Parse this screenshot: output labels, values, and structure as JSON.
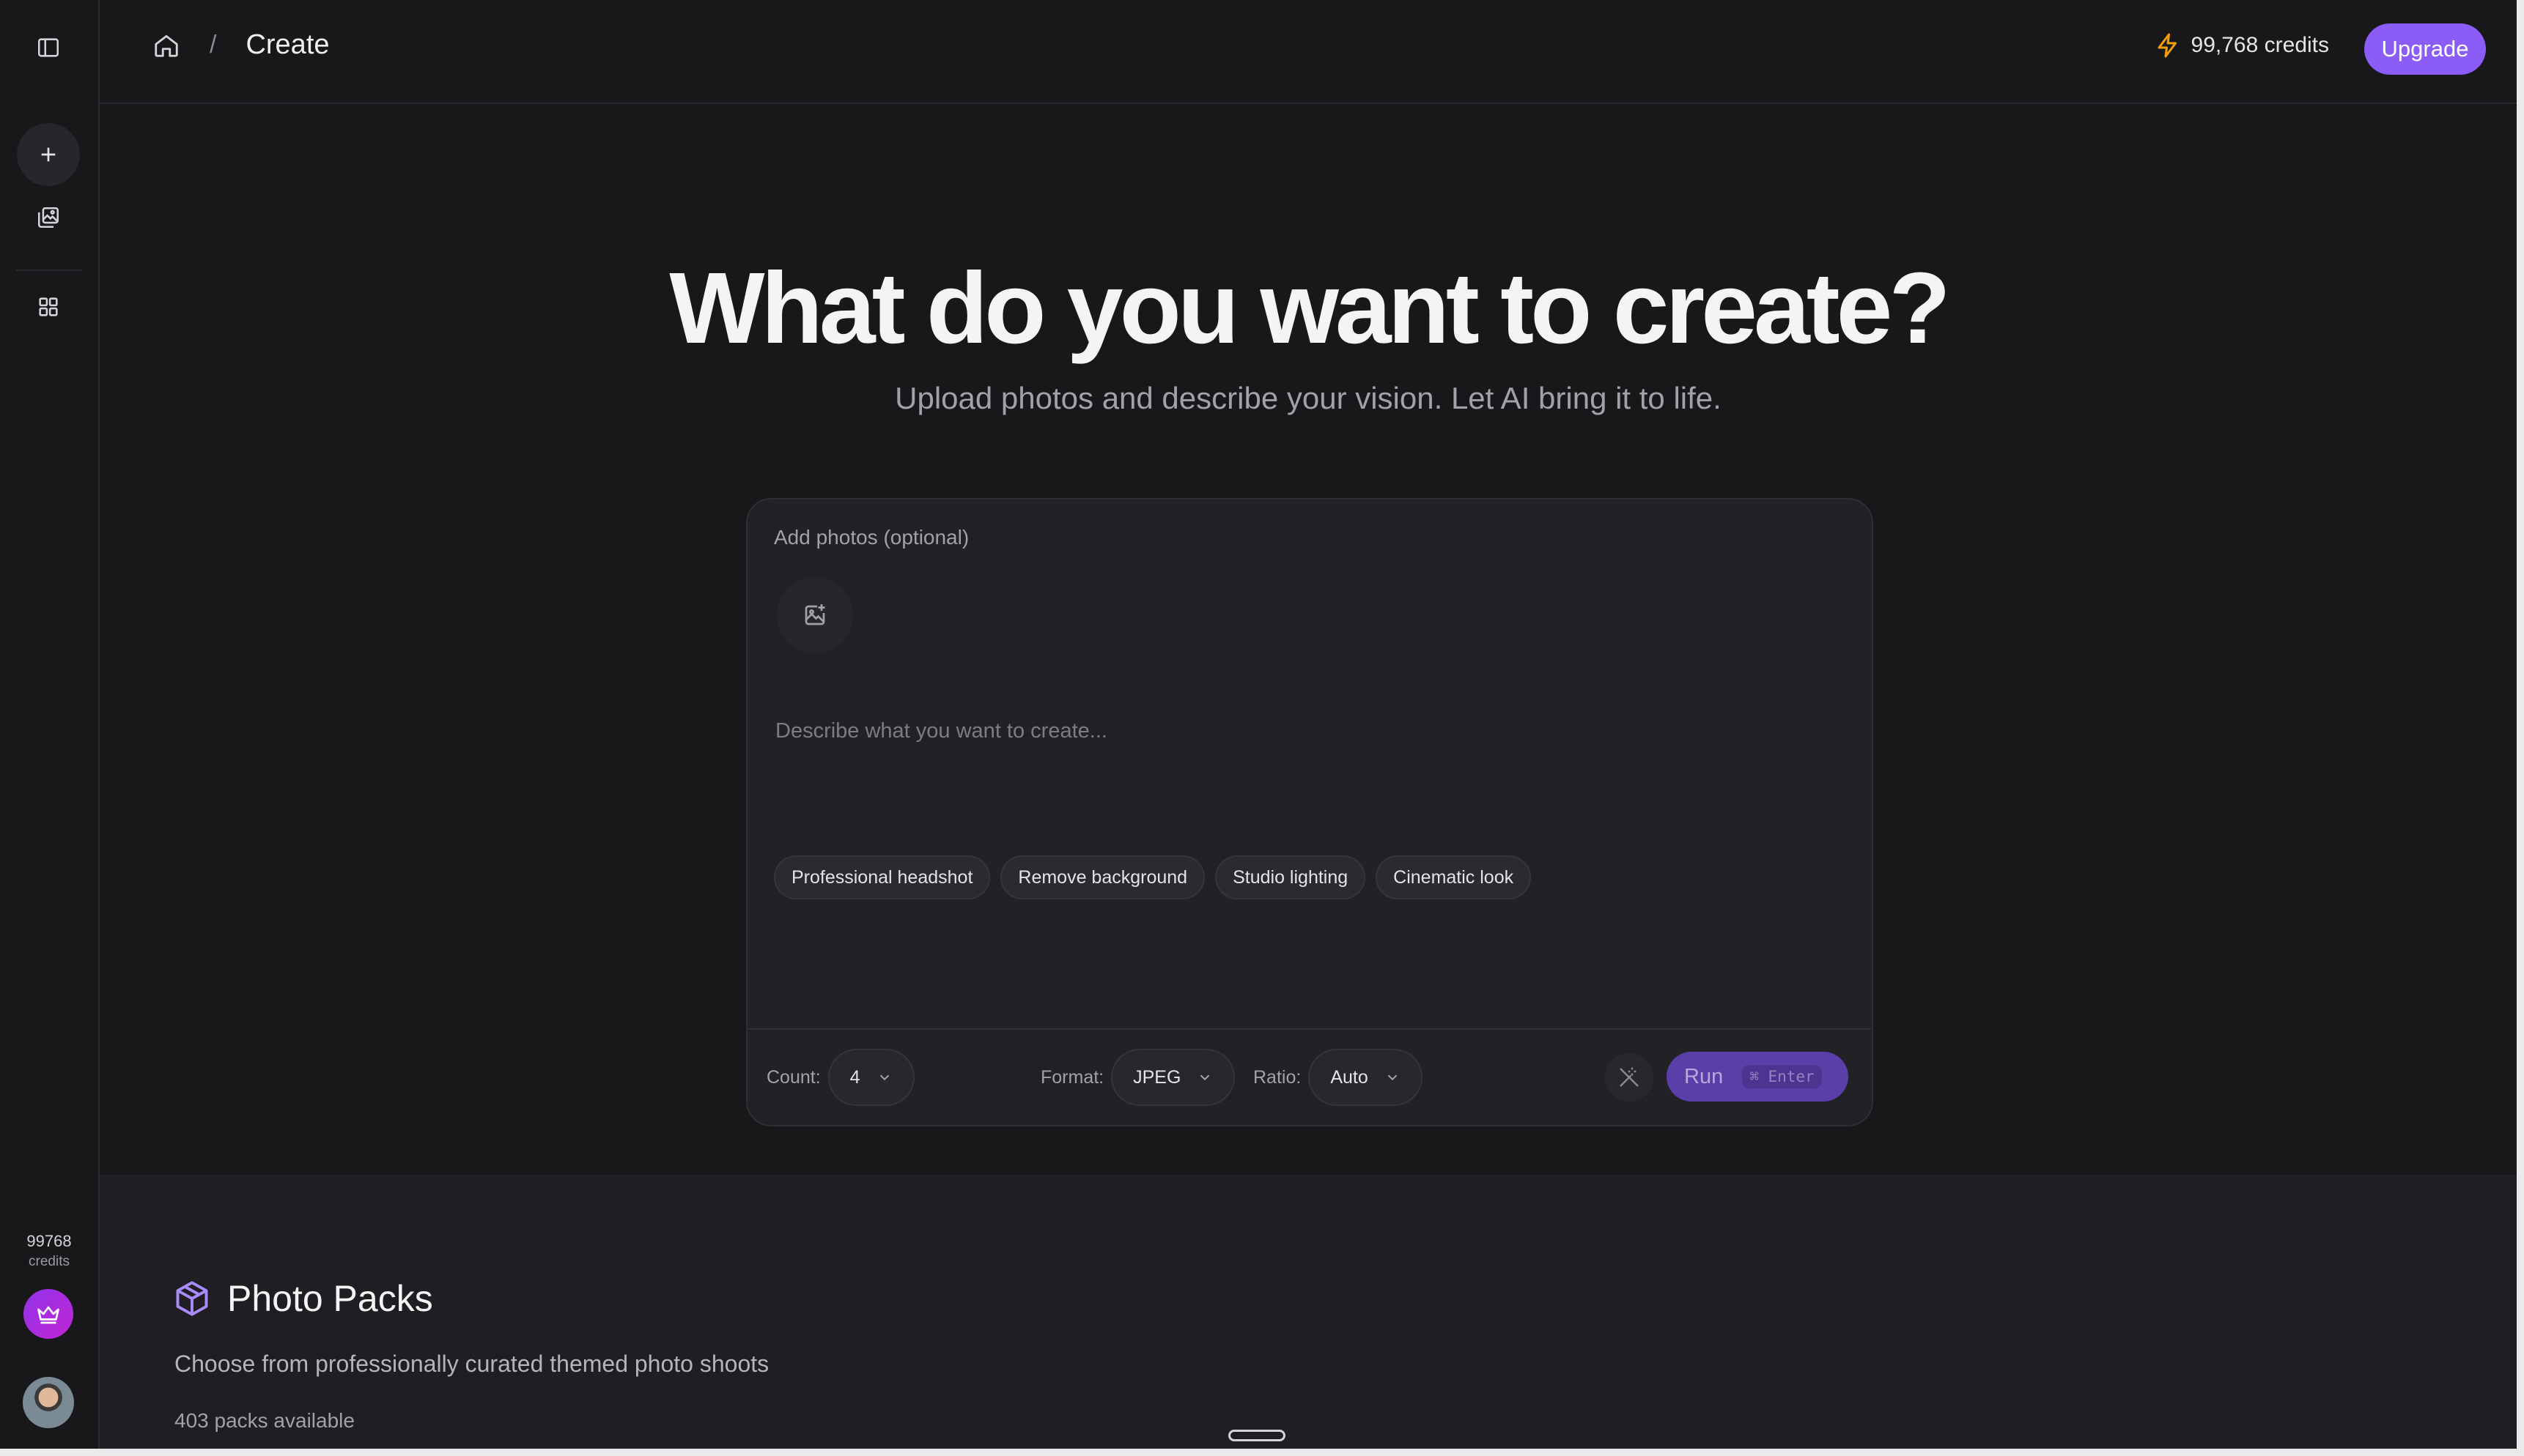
{
  "breadcrumb": {
    "current": "Create",
    "separator": "/"
  },
  "header": {
    "credits": "99,768 credits",
    "upgrade_label": "Upgrade",
    "accent": "#8b5cf6"
  },
  "sidebar": {
    "credits_number": "99768",
    "credits_label": "credits"
  },
  "hero": {
    "title": "What do you want to create?",
    "subtitle": "Upload photos and describe your vision. Let AI bring it to life."
  },
  "composer": {
    "photos_label": "Add photos (optional)",
    "prompt_placeholder": "Describe what you want to create...",
    "chips": [
      "Professional headshot",
      "Remove background",
      "Studio lighting",
      "Cinematic look"
    ],
    "count_label": "Count:",
    "count_value": "4",
    "format_label": "Format:",
    "format_value": "JPEG",
    "ratio_label": "Ratio:",
    "ratio_value": "Auto",
    "run_label": "Run",
    "run_shortcut": "⌘ Enter"
  },
  "packs": {
    "title": "Photo Packs",
    "subtitle": "Choose from professionally curated themed photo shoots",
    "count": "403 packs available"
  }
}
